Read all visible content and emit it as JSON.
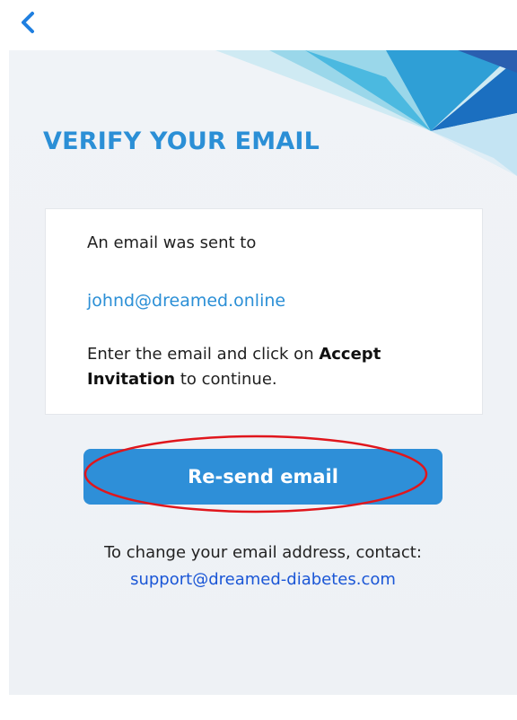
{
  "header": {
    "back_icon": "chevron-left-icon"
  },
  "page": {
    "title": "VERIFY YOUR EMAIL"
  },
  "card": {
    "sent_text": "An email was sent to",
    "email": "johnd@dreamed.online",
    "instruction_before": "Enter the email and click on ",
    "instruction_bold": "Accept Invitation",
    "instruction_after": " to continue."
  },
  "actions": {
    "resend_label": "Re-send email"
  },
  "footer": {
    "change_text": "To change your email address, contact:",
    "support_email": "support@dreamed-diabetes.com"
  },
  "colors": {
    "accent": "#2b8fd6",
    "button": "#2e8fd8",
    "link": "#1a56d6",
    "highlight_ring": "#e0161c",
    "background": "#eef1f5"
  }
}
